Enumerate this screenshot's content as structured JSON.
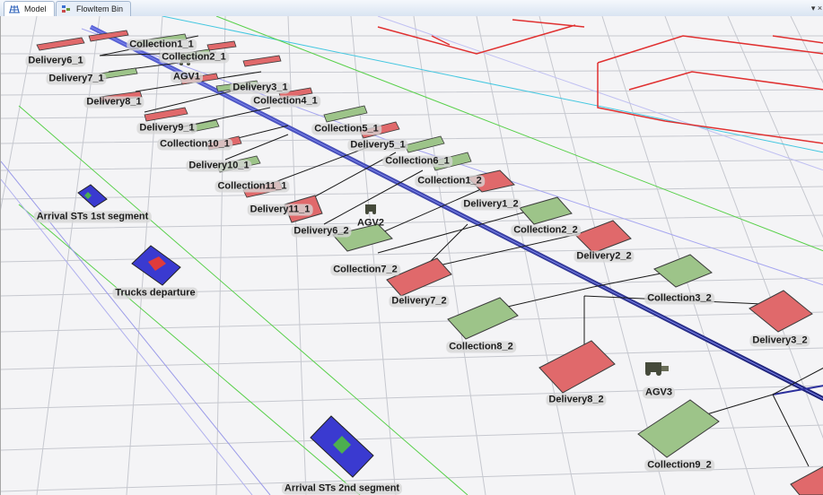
{
  "tabs": [
    {
      "label": "Model",
      "icon": "grid-model-icon",
      "active": true
    },
    {
      "label": "FlowItem Bin",
      "icon": "flowitem-bin-icon",
      "active": false
    }
  ],
  "menu_glyph": "▾ ×",
  "colors": {
    "delivery": "#e0696b",
    "collection": "#9dc489",
    "arrival": "#3a3ad0",
    "track": "#2b2f9c",
    "fence": "#e03030"
  },
  "labels": {
    "delivery6_1": "Delivery6_1",
    "collection1_1": "Collection1_1",
    "collection2_1": "Collection2_1",
    "delivery7_1": "Delivery7_1",
    "agv1": "AGV1",
    "delivery3_1": "Delivery3_1",
    "delivery8_1": "Delivery8_1",
    "collection4_1": "Collection4_1",
    "delivery9_1": "Delivery9_1",
    "collection5_1": "Collection5_1",
    "collection10_1": "Collection10_1",
    "delivery5_1": "Delivery5_1",
    "delivery10_1": "Delivery10_1",
    "collection6_1": "Collection6_1",
    "collection11_1": "Collection11_1",
    "collection1_2": "Collection1_2",
    "delivery11_1": "Delivery11_1",
    "delivery1_2": "Delivery1_2",
    "agv2": "AGV2",
    "delivery6_2": "Delivery6_2",
    "collection2_2": "Collection2_2",
    "delivery2_2": "Delivery2_2",
    "collection7_2": "Collection7_2",
    "delivery7_2": "Delivery7_2",
    "collection3_2": "Collection3_2",
    "delivery3_2": "Delivery3_2",
    "collection8_2": "Collection8_2",
    "agv3": "AGV3",
    "delivery8_2": "Delivery8_2",
    "collection9_2": "Collection9_2",
    "arrival_1st": "Arrival STs 1st segment",
    "trucks_departure": "Trucks departure",
    "arrival_2nd": "Arrival STs 2nd segment"
  }
}
